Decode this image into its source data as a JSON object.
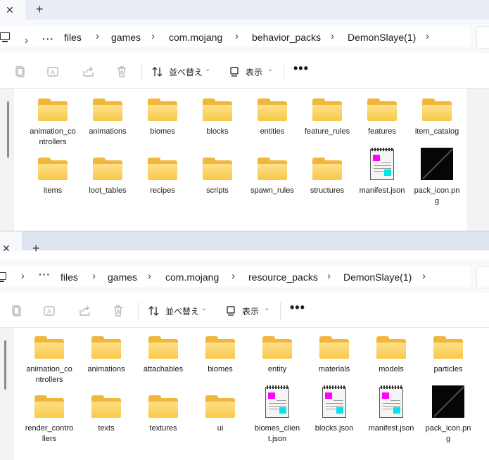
{
  "windows": [
    {
      "id": "top",
      "tab": {
        "close_glyph": "✕",
        "new_glyph": "+"
      },
      "breadcrumb": [
        "files",
        "games",
        "com.mojang",
        "behavior_packs",
        "DemonSlaye(1)"
      ],
      "toolbar": {
        "sort_label": "並べ替え",
        "view_label": "表示",
        "more_label": "•••"
      },
      "items": [
        {
          "name": "animation_controllers",
          "type": "folder"
        },
        {
          "name": "animations",
          "type": "folder"
        },
        {
          "name": "biomes",
          "type": "folder"
        },
        {
          "name": "blocks",
          "type": "folder"
        },
        {
          "name": "entities",
          "type": "folder"
        },
        {
          "name": "feature_rules",
          "type": "folder"
        },
        {
          "name": "features",
          "type": "folder"
        },
        {
          "name": "item_catalog",
          "type": "folder"
        },
        {
          "name": "items",
          "type": "folder"
        },
        {
          "name": "loot_tables",
          "type": "folder"
        },
        {
          "name": "recipes",
          "type": "folder"
        },
        {
          "name": "scripts",
          "type": "folder"
        },
        {
          "name": "spawn_rules",
          "type": "folder"
        },
        {
          "name": "structures",
          "type": "folder"
        },
        {
          "name": "manifest.json",
          "type": "json"
        },
        {
          "name": "pack_icon.png",
          "type": "png"
        }
      ]
    },
    {
      "id": "bottom",
      "tab": {
        "close_glyph": "✕",
        "new_glyph": "+"
      },
      "breadcrumb": [
        "files",
        "games",
        "com.mojang",
        "resource_packs",
        "DemonSlaye(1)"
      ],
      "toolbar": {
        "sort_label": "並べ替え",
        "view_label": "表示",
        "more_label": "•••"
      },
      "items": [
        {
          "name": "animation_controllers",
          "type": "folder"
        },
        {
          "name": "animations",
          "type": "folder"
        },
        {
          "name": "attachables",
          "type": "folder"
        },
        {
          "name": "biomes",
          "type": "folder"
        },
        {
          "name": "entity",
          "type": "folder"
        },
        {
          "name": "materials",
          "type": "folder"
        },
        {
          "name": "models",
          "type": "folder"
        },
        {
          "name": "particles",
          "type": "folder"
        },
        {
          "name": "render_controllers",
          "type": "folder"
        },
        {
          "name": "texts",
          "type": "folder"
        },
        {
          "name": "textures",
          "type": "folder"
        },
        {
          "name": "ui",
          "type": "folder"
        },
        {
          "name": "biomes_client.json",
          "type": "json"
        },
        {
          "name": "blocks.json",
          "type": "json"
        },
        {
          "name": "manifest.json",
          "type": "json"
        },
        {
          "name": "pack_icon.png",
          "type": "png"
        }
      ]
    }
  ],
  "icons": {
    "pc": "computer-icon",
    "chevron": "chevron-right-icon",
    "more": "more-dots-icon",
    "copy": "copy-icon",
    "rename": "rename-icon",
    "share": "share-icon",
    "delete": "trash-icon",
    "sort": "sort-icon",
    "view": "view-icon",
    "folder": "folder-icon",
    "json": "json-file-icon",
    "png": "image-file-icon"
  },
  "colors": {
    "folder": "#f0b73b",
    "json_magenta": "#ff00ff",
    "json_cyan": "#00e5e5"
  }
}
